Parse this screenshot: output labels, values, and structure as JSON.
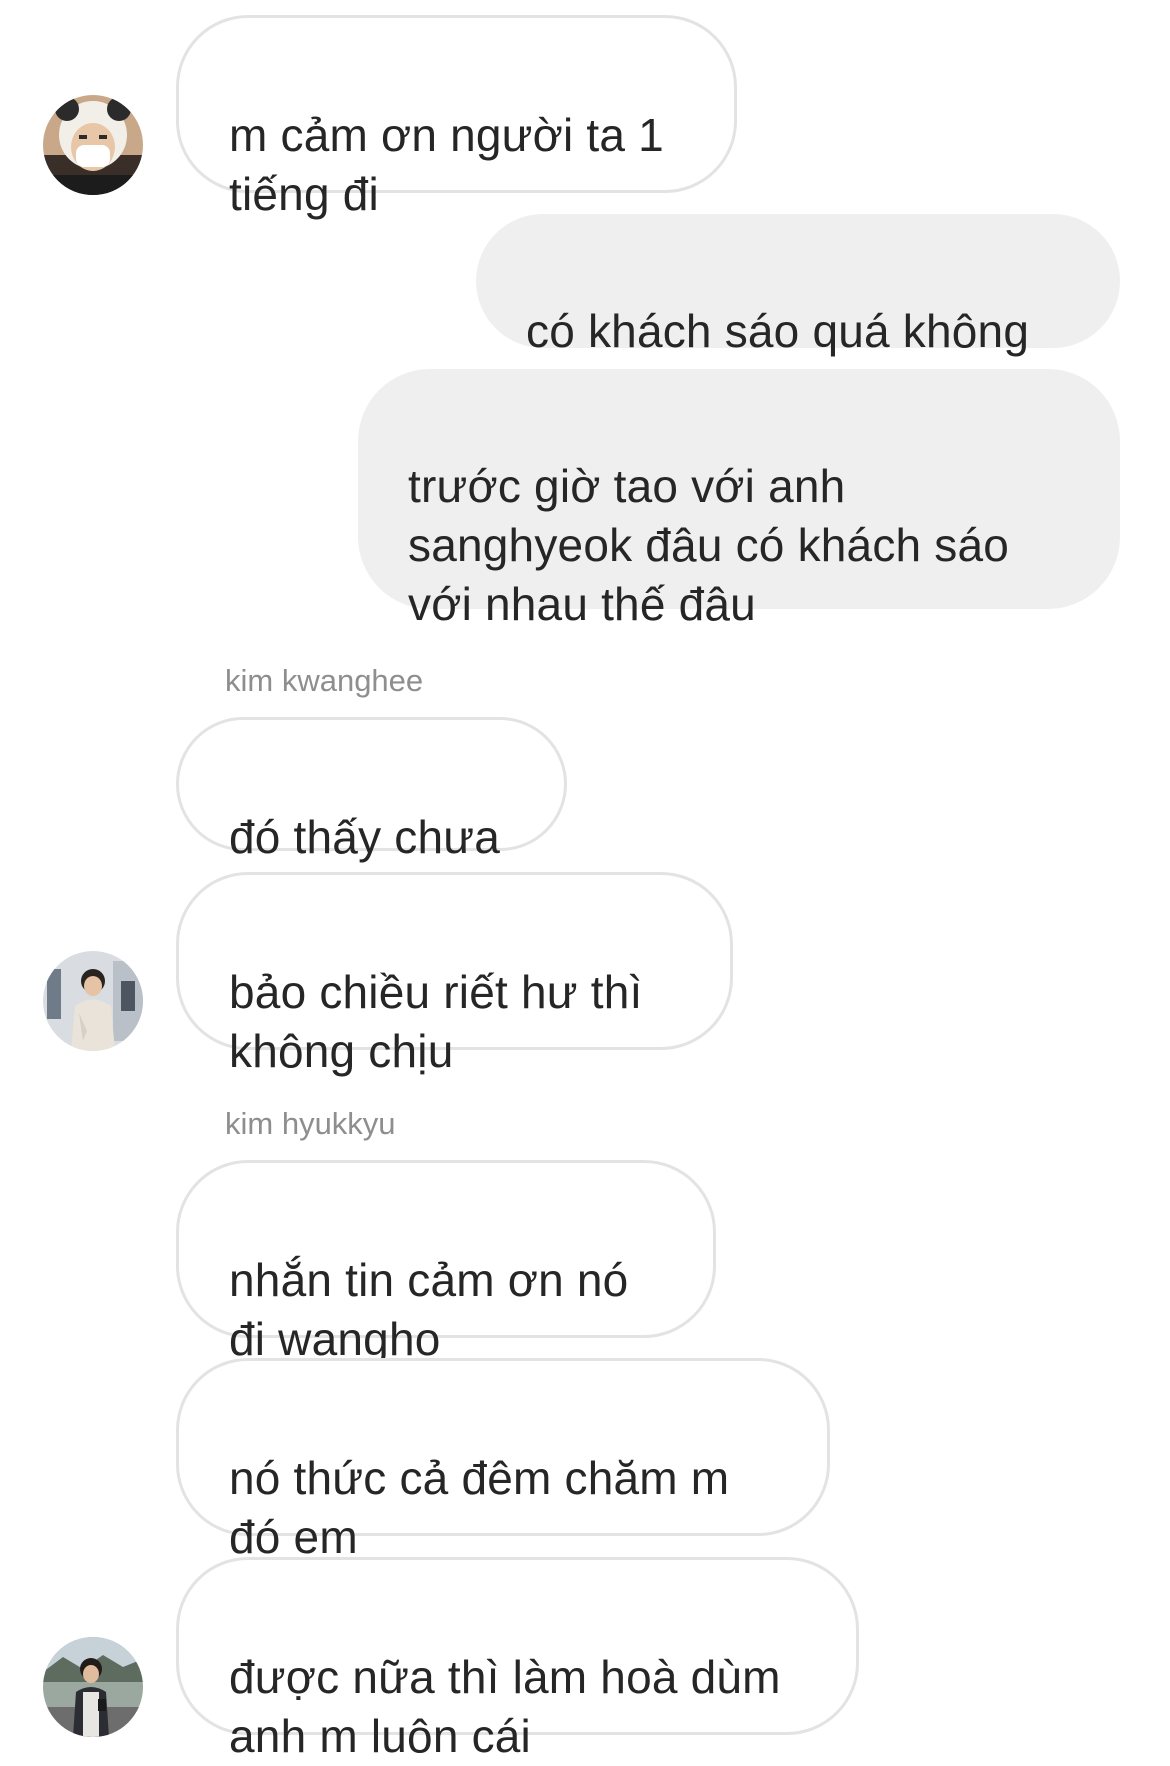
{
  "chat": {
    "messages": [
      {
        "text": "m cảm ơn người ta 1\ntiếng đi"
      },
      {
        "text": "có khách sáo quá không"
      },
      {
        "text": "trước giờ tao với anh\nsanghyeok đâu có khách sáo\nvới nhau thế đâu"
      },
      {
        "text": "đó thấy chưa"
      },
      {
        "text": "bảo chiều riết hư thì\nkhông chịu"
      },
      {
        "text": "nhắn tin cảm ơn nó\nđi wangho"
      },
      {
        "text": "nó thức cả đêm chăm m\nđó em"
      },
      {
        "text": "được nữa thì làm hoà dùm\nanh m luôn cái"
      }
    ],
    "senders": {
      "kwanghee": "kim kwanghee",
      "hyukkyu": "kim hyukkyu"
    },
    "avatars": [
      "panda-hat-avatar",
      "hoodie-avatar",
      "street-avatar"
    ]
  }
}
